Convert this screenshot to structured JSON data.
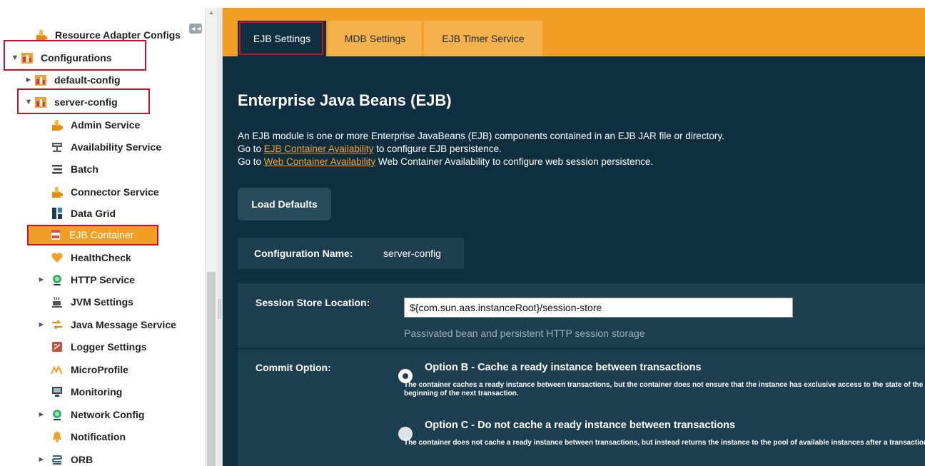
{
  "tree": {
    "items": [
      {
        "label": "Resource Adapter Configs",
        "icon": "puzzle-icon",
        "twisty": ""
      },
      {
        "label": "Configurations",
        "icon": "config-icon",
        "twisty": "▼"
      },
      {
        "label": "default-config",
        "icon": "config-icon",
        "twisty": "►"
      },
      {
        "label": "server-config",
        "icon": "config-icon",
        "twisty": "▼"
      },
      {
        "label": "Admin Service",
        "icon": "puzzle-icon",
        "twisty": ""
      },
      {
        "label": "Availability Service",
        "icon": "availability-icon",
        "twisty": ""
      },
      {
        "label": "Batch",
        "icon": "batch-icon",
        "twisty": ""
      },
      {
        "label": "Connector Service",
        "icon": "puzzle-icon",
        "twisty": ""
      },
      {
        "label": "Data Grid",
        "icon": "data-grid-icon",
        "twisty": ""
      },
      {
        "label": "EJB Container",
        "icon": "jar-icon",
        "twisty": ""
      },
      {
        "label": "HealthCheck",
        "icon": "heart-icon",
        "twisty": ""
      },
      {
        "label": "HTTP Service",
        "icon": "globe-icon",
        "twisty": "►"
      },
      {
        "label": "JVM Settings",
        "icon": "coffee-icon",
        "twisty": ""
      },
      {
        "label": "Java Message Service",
        "icon": "arrows-icon",
        "twisty": "►"
      },
      {
        "label": "Logger Settings",
        "icon": "logger-icon",
        "twisty": ""
      },
      {
        "label": "MicroProfile",
        "icon": "microprofile-icon",
        "twisty": ""
      },
      {
        "label": "Monitoring",
        "icon": "monitor-icon",
        "twisty": ""
      },
      {
        "label": "Network Config",
        "icon": "globe-icon",
        "twisty": "►"
      },
      {
        "label": "Notification",
        "icon": "bell-icon",
        "twisty": ""
      },
      {
        "label": "ORB",
        "icon": "orb-icon",
        "twisty": "►"
      }
    ],
    "collapse_glyph": "◄◄"
  },
  "tabs": [
    {
      "label": "EJB Settings",
      "active": true
    },
    {
      "label": "MDB Settings",
      "active": false
    },
    {
      "label": "EJB Timer Service",
      "active": false
    }
  ],
  "page": {
    "title": "Enterprise Java Beans (EJB)",
    "desc_line1": "An EJB module is one or more Enterprise JavaBeans (EJB) components contained in an EJB JAR file or directory.",
    "desc_line2_prefix": "Go to ",
    "desc_line2_link": "EJB Container Availability",
    "desc_line2_suffix": " to configure EJB persistence.",
    "desc_line3_prefix": "Go to ",
    "desc_line3_link": "Web Container Availability",
    "desc_line3_suffix": " Web Container Availability to configure web session persistence."
  },
  "buttons": {
    "load_defaults": "Load Defaults"
  },
  "config": {
    "label": "Configuration Name:",
    "value": "server-config"
  },
  "session_store": {
    "label": "Session Store Location:",
    "value": "${com.sun.aas.instanceRoot}/session-store",
    "help": "Passivated bean and persistent HTTP session storage"
  },
  "commit": {
    "label": "Commit Option:",
    "option_b_title": "Option B - Cache a ready instance between transactions",
    "option_b_desc_1": "The container caches a ready instance between transactions, but the container does not ensure that the instance has exclusive access to the state of the object. The container synchronizes the instance's state at the",
    "option_b_desc_2": "beginning of the next transaction.",
    "option_b_selected": true,
    "option_c_title": "Option C - Do not cache a ready instance between transactions",
    "option_c_desc": "The container does not cache a ready instance between transactions, but instead returns the instance to the pool of available instances after a transaction has completed."
  },
  "colors": {
    "accent": "#f29f25",
    "panel_dark": "#0f2f3f",
    "panel_mid": "#1d3e4e",
    "link": "#f2a23a",
    "highlight_border": "#c8102e"
  }
}
